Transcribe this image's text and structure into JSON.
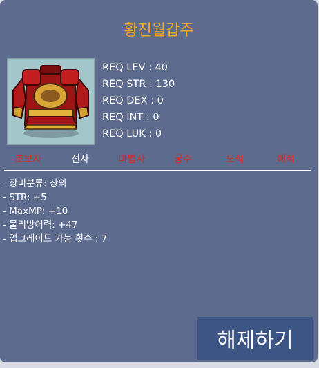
{
  "item": {
    "name": "황진월갑주",
    "image_icon": "red-gold-armor-icon"
  },
  "requirements": [
    "REQ LEV : 40",
    "REQ STR : 130",
    "REQ DEX : 0",
    "REQ INT : 0",
    "REQ LUK : 0"
  ],
  "jobs": [
    {
      "label": "초보자",
      "allowed": false
    },
    {
      "label": "전사",
      "allowed": true
    },
    {
      "label": "마법사",
      "allowed": false
    },
    {
      "label": "궁수",
      "allowed": false
    },
    {
      "label": "도적",
      "allowed": false
    },
    {
      "label": "해적",
      "allowed": false
    }
  ],
  "stats": [
    "- 장비분류: 상의",
    "- STR: +5",
    "- MaxMP: +10",
    "- 물리방어력: +47",
    "- 업그레이드 가능 횟수 : 7"
  ],
  "action_button": {
    "label": "해제하기"
  },
  "colors": {
    "panel_bg": "#5d6b8e",
    "title": "#f2a720",
    "job_disallowed": "#e5261a",
    "job_allowed": "#ffffff",
    "button_bg": "#3d5585"
  }
}
